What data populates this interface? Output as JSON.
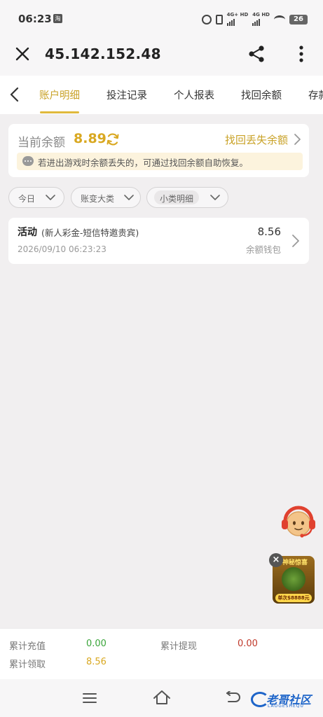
{
  "status_bar": {
    "time": "06:23",
    "app_badge": "淘",
    "battery": "26",
    "net1": "4G+ HD",
    "net2": "4G HD"
  },
  "browser": {
    "url": "45.142.152.48"
  },
  "tabs": [
    {
      "label": "账户明细",
      "active": true
    },
    {
      "label": "投注记录",
      "active": false
    },
    {
      "label": "个人报表",
      "active": false
    },
    {
      "label": "找回余额",
      "active": false
    },
    {
      "label": "存款",
      "active": false
    }
  ],
  "balance": {
    "label": "当前余额",
    "value": "8.89",
    "recover_link": "找回丢失余额",
    "notice": "若进出游戏时余额丢失的，可通过找回余额自助恢复。"
  },
  "filters": [
    {
      "label": "今日"
    },
    {
      "label": "账变大类"
    },
    {
      "label": "小类明细"
    }
  ],
  "records": [
    {
      "title": "活动",
      "subtitle": "(新人彩金-短信特邀贵宾)",
      "time": "2026/09/10 06:23:23",
      "amount": "8.56",
      "wallet": "余额钱包"
    }
  ],
  "promo": {
    "title": "神秘惊喜",
    "bar": "单次$8888元"
  },
  "summary": {
    "recharge_label": "累计充值",
    "recharge_value": "0.00",
    "withdraw_label": "累计提现",
    "withdraw_value": "0.00",
    "claim_label": "累计领取",
    "claim_value": "8.56"
  },
  "watermark": {
    "text": "老哥社区",
    "sub": "LAOGESHEQU"
  },
  "colors": {
    "accent": "#d9a821",
    "green": "#3aa53a",
    "red": "#c0392b",
    "link": "#1d64c9"
  }
}
